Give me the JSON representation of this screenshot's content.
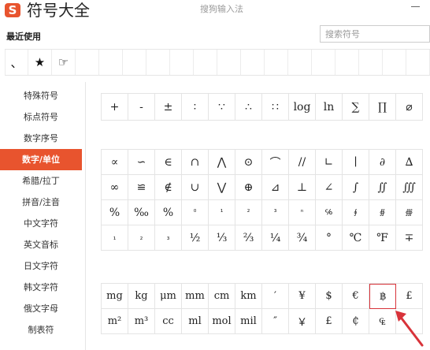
{
  "app": {
    "logo": "S",
    "title": "符号大全",
    "caption": "搜狗输入法"
  },
  "recent": {
    "label": "最近使用",
    "items": [
      "、",
      "★",
      "☞",
      "",
      "",
      "",
      "",
      "",
      "",
      "",
      "",
      "",
      "",
      "",
      "",
      "",
      "",
      ""
    ]
  },
  "search": {
    "placeholder": "搜索符号",
    "value": ""
  },
  "sidebar": {
    "active_index": 3,
    "items": [
      "特殊符号",
      "标点符号",
      "数字序号",
      "数字/单位",
      "希腊/拉丁",
      "拼音/注音",
      "中文字符",
      "英文音标",
      "日文字符",
      "韩文字符",
      "俄文字母",
      "制表符"
    ]
  },
  "grids": [
    [
      "+",
      "-",
      "±",
      "∶",
      "∵",
      "∴",
      "∷",
      "log",
      "ln",
      "∑",
      "∏",
      "⌀"
    ],
    [
      "∝",
      "∽",
      "∈",
      "∩",
      "⋀",
      "⊙",
      "⌒",
      "//",
      "∟",
      "∣",
      "∂",
      "∆",
      "∞",
      "≌",
      "∉",
      "∪",
      "⋁",
      "⊕",
      "⊿",
      "⊥",
      "∠",
      "∫",
      "∬",
      "∭",
      "%",
      "‰",
      "%",
      "⁰",
      "¹",
      "²",
      "³",
      "ⁿ",
      "℅",
      "∮",
      "∯",
      "∰",
      "₁",
      "₂",
      "₃",
      "½",
      "⅓",
      "⅔",
      "¼",
      "¾",
      "°",
      "℃",
      "℉",
      "∓"
    ],
    [
      "mg",
      "kg",
      "μm",
      "mm",
      "cm",
      "km",
      "′",
      "¥",
      "$",
      "€",
      "฿",
      "£",
      "m²",
      "m³",
      "cc",
      "ml",
      "mol",
      "mil",
      "″",
      "￥",
      "£",
      "₵",
      "₠",
      ""
    ]
  ],
  "highlight": {
    "grid": 2,
    "index": 10
  },
  "icons": {
    "minimize": "minimize-icon",
    "arrow": "red-arrow-annotation"
  },
  "colors": {
    "accent": "#e8542e",
    "highlight": "#d8333a"
  }
}
